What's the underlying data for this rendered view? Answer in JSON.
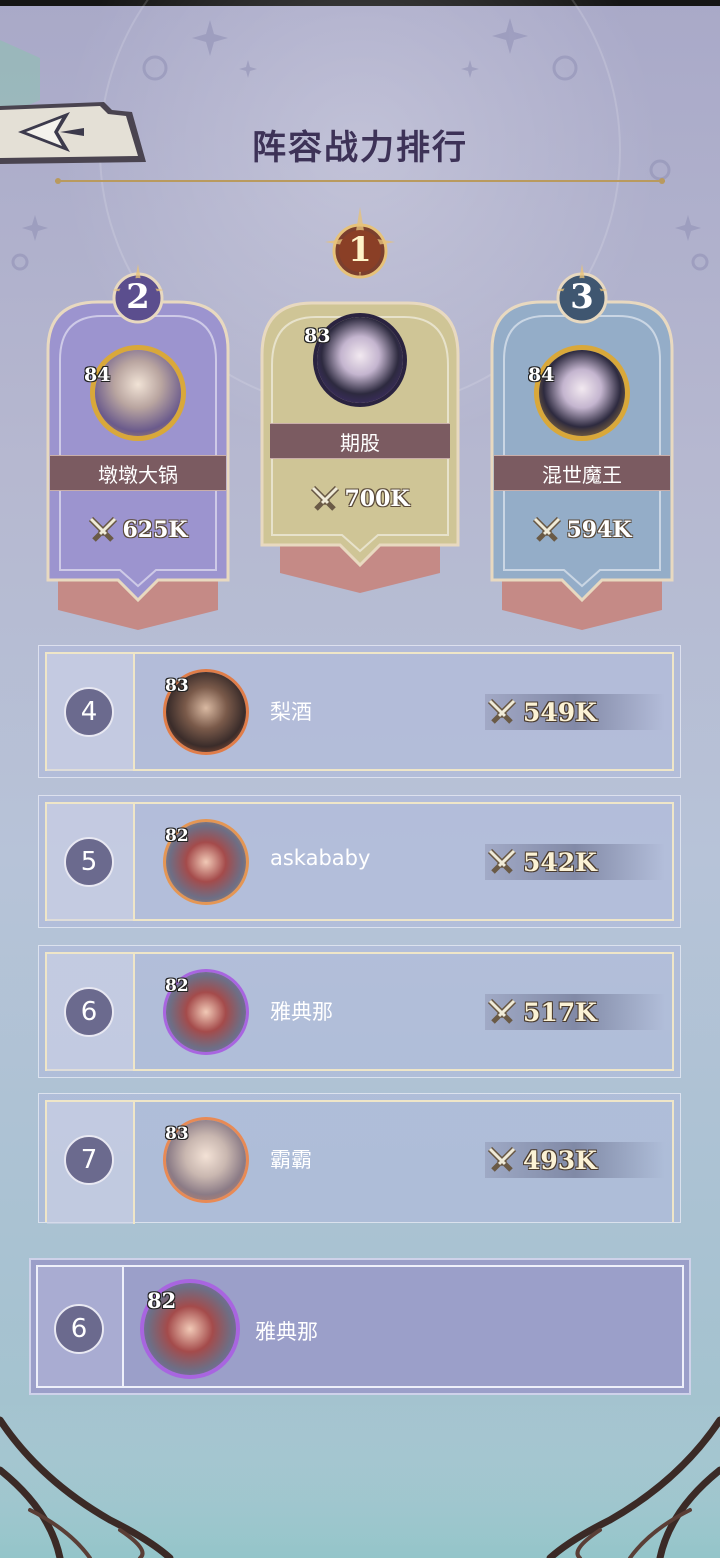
{
  "page": {
    "title": "阵容战力排行"
  },
  "podium": [
    {
      "rank": "2",
      "level": "84",
      "name": "墩墩大锅",
      "power": "625K"
    },
    {
      "rank": "1",
      "level": "83",
      "name": "期股",
      "power": "700K"
    },
    {
      "rank": "3",
      "level": "84",
      "name": "混世魔王",
      "power": "594K"
    }
  ],
  "rows": [
    {
      "rank": "4",
      "level": "83",
      "name": "梨酒",
      "power": "549K"
    },
    {
      "rank": "5",
      "level": "82",
      "name": "askababy",
      "power": "542K"
    },
    {
      "rank": "6",
      "level": "82",
      "name": "雅典那",
      "power": "517K"
    },
    {
      "rank": "7",
      "level": "83",
      "name": "霸霸",
      "power": "493K"
    }
  ],
  "self": {
    "rank": "6",
    "level": "82",
    "name": "雅典那"
  },
  "icons": {
    "back": "back-arrow-icon",
    "power": "crossed-swords-icon"
  },
  "colors": {
    "title": "#3d3257",
    "rank1_card": "#cfc596",
    "rank2_card": "#9c94cf",
    "rank3_card": "#94adc8",
    "nameband": "#7b5b61",
    "rank_circle": "#6b6a8e"
  }
}
